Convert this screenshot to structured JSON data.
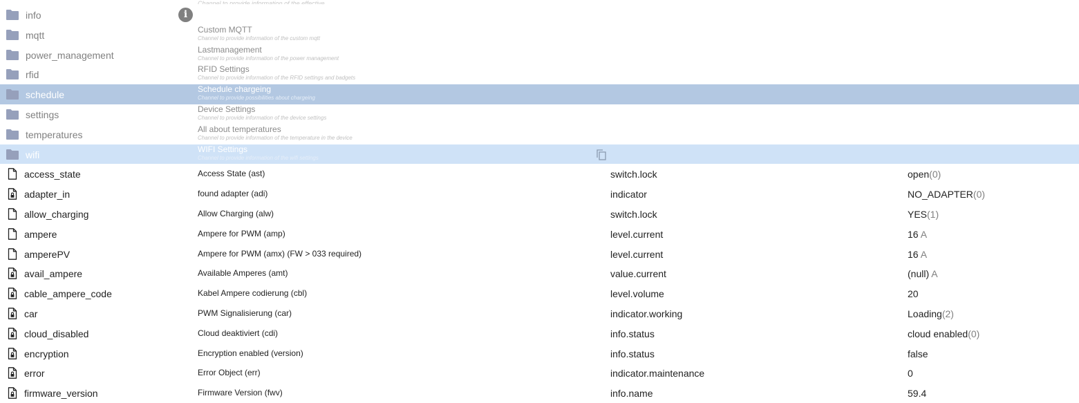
{
  "faint_top_text": "Channel to provide information of the effective ...",
  "channels": [
    {
      "name": "info",
      "title": "",
      "desc": "",
      "state": "normal"
    },
    {
      "name": "mqtt",
      "title": "Custom MQTT",
      "desc": "Channel to provide information of the custom mqtt",
      "state": "normal"
    },
    {
      "name": "power_management",
      "title": "Lastmanagement",
      "desc": "Channel to provide information of the power management",
      "state": "normal"
    },
    {
      "name": "rfid",
      "title": "RFID Settings",
      "desc": "Channel to provide information of the RFID settings and badgets",
      "state": "normal"
    },
    {
      "name": "schedule",
      "title": "Schedule chargeing",
      "desc": "Channel to provide possibilities about chargeing",
      "state": "selected"
    },
    {
      "name": "settings",
      "title": "Device Settings",
      "desc": "Channel to provide information of the device settings",
      "state": "normal"
    },
    {
      "name": "temperatures",
      "title": "All about temperatures",
      "desc": "Channel to provide information of the temperature in the device",
      "state": "normal"
    },
    {
      "name": "wifi",
      "title": "WIFI Settings",
      "desc": "Channel to provide information of the wifi settings",
      "state": "hover"
    }
  ],
  "states": [
    {
      "name": "access_state",
      "desc": "Access State (ast)",
      "role": "switch.lock",
      "value": "open",
      "suffix": "(0)",
      "icon": "file-icon"
    },
    {
      "name": "adapter_in",
      "desc": "found adapter (adi)",
      "role": "indicator",
      "value": "NO_ADAPTER",
      "suffix": "(0)",
      "icon": "file-lock-icon"
    },
    {
      "name": "allow_charging",
      "desc": "Allow Charging (alw)",
      "role": "switch.lock",
      "value": "YES",
      "suffix": "(1)",
      "icon": "file-icon"
    },
    {
      "name": "ampere",
      "desc": "Ampere for PWM (amp)",
      "role": "level.current",
      "value": "16",
      "suffix": " A",
      "icon": "file-icon"
    },
    {
      "name": "amperePV",
      "desc": "Ampere for PWM (amx) (FW > 033 required)",
      "role": "level.current",
      "value": "16",
      "suffix": " A",
      "icon": "file-icon"
    },
    {
      "name": "avail_ampere",
      "desc": "Available Amperes (amt)",
      "role": "value.current",
      "value": "(null)",
      "suffix": " A",
      "icon": "file-lock-icon"
    },
    {
      "name": "cable_ampere_code",
      "desc": "Kabel Ampere codierung (cbl)",
      "role": "level.volume",
      "value": "20",
      "suffix": "",
      "icon": "file-lock-icon"
    },
    {
      "name": "car",
      "desc": "PWM Signalisierung (car)",
      "role": "indicator.working",
      "value": "Loading",
      "suffix": "(2)",
      "icon": "file-lock-icon"
    },
    {
      "name": "cloud_disabled",
      "desc": "Cloud deaktiviert (cdi)",
      "role": "info.status",
      "value": "cloud enabled",
      "suffix": "(0)",
      "icon": "file-lock-icon"
    },
    {
      "name": "encryption",
      "desc": "Encryption enabled (version)",
      "role": "info.status",
      "value": "false",
      "suffix": "",
      "icon": "file-lock-icon"
    },
    {
      "name": "error",
      "desc": "Error Object (err)",
      "role": "indicator.maintenance",
      "value": "0",
      "suffix": "",
      "icon": "file-lock-icon"
    },
    {
      "name": "firmware_version",
      "desc": "Firmware Version (fwv)",
      "role": "info.name",
      "value": "59.4",
      "suffix": "",
      "icon": "file-lock-icon"
    }
  ],
  "colors": {
    "folder": "#96a0bb",
    "selected_row": "#b3c8e2",
    "hover_row": "#cfe2f7"
  }
}
